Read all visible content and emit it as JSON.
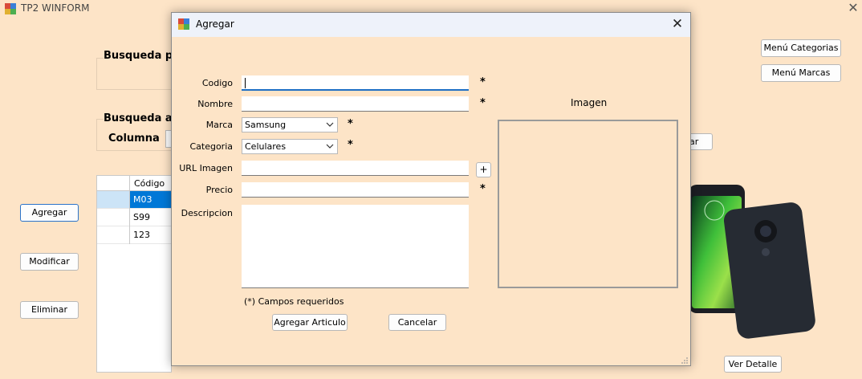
{
  "main": {
    "title": "TP2 WINFORM",
    "close_glyph": "✕",
    "menu_categorias": "Menú Categorias",
    "menu_marcas": "Menú Marcas",
    "busqueda_rapida": "Busqueda p",
    "busqueda_avanzada": "Busqueda a",
    "columna_label": "Columna",
    "filtrar_partial": "ar",
    "grid": {
      "header": "Código",
      "rows": [
        "M03",
        "S99",
        "123"
      ]
    },
    "agregar": "Agregar",
    "modificar": "Modificar",
    "eliminar": "Eliminar",
    "ver_detalle": "Ver Detalle"
  },
  "dialog": {
    "title": "Agregar",
    "close_glyph": "✕",
    "labels": {
      "codigo": "Codigo",
      "nombre": "Nombre",
      "marca": "Marca",
      "categoria": "Categoria",
      "url_imagen": "URL Imagen",
      "precio": "Precio",
      "descripcion": "Descripcion",
      "imagen": "Imagen"
    },
    "values": {
      "codigo": "",
      "nombre": "",
      "marca": "Samsung",
      "categoria": "Celulares",
      "url_imagen": "",
      "precio": "",
      "descripcion": ""
    },
    "required_mark": "*",
    "add_image_button": "+",
    "required_note": "(*) Campos requeridos",
    "agregar_articulo": "Agregar Articulo",
    "cancelar": "Cancelar"
  },
  "colors": {
    "background": "#fde4c7",
    "selection": "#0078d7",
    "focus": "#1e6fc4"
  },
  "icons": [
    "app-icon",
    "close-icon",
    "chevron-down-icon",
    "phone-image"
  ]
}
